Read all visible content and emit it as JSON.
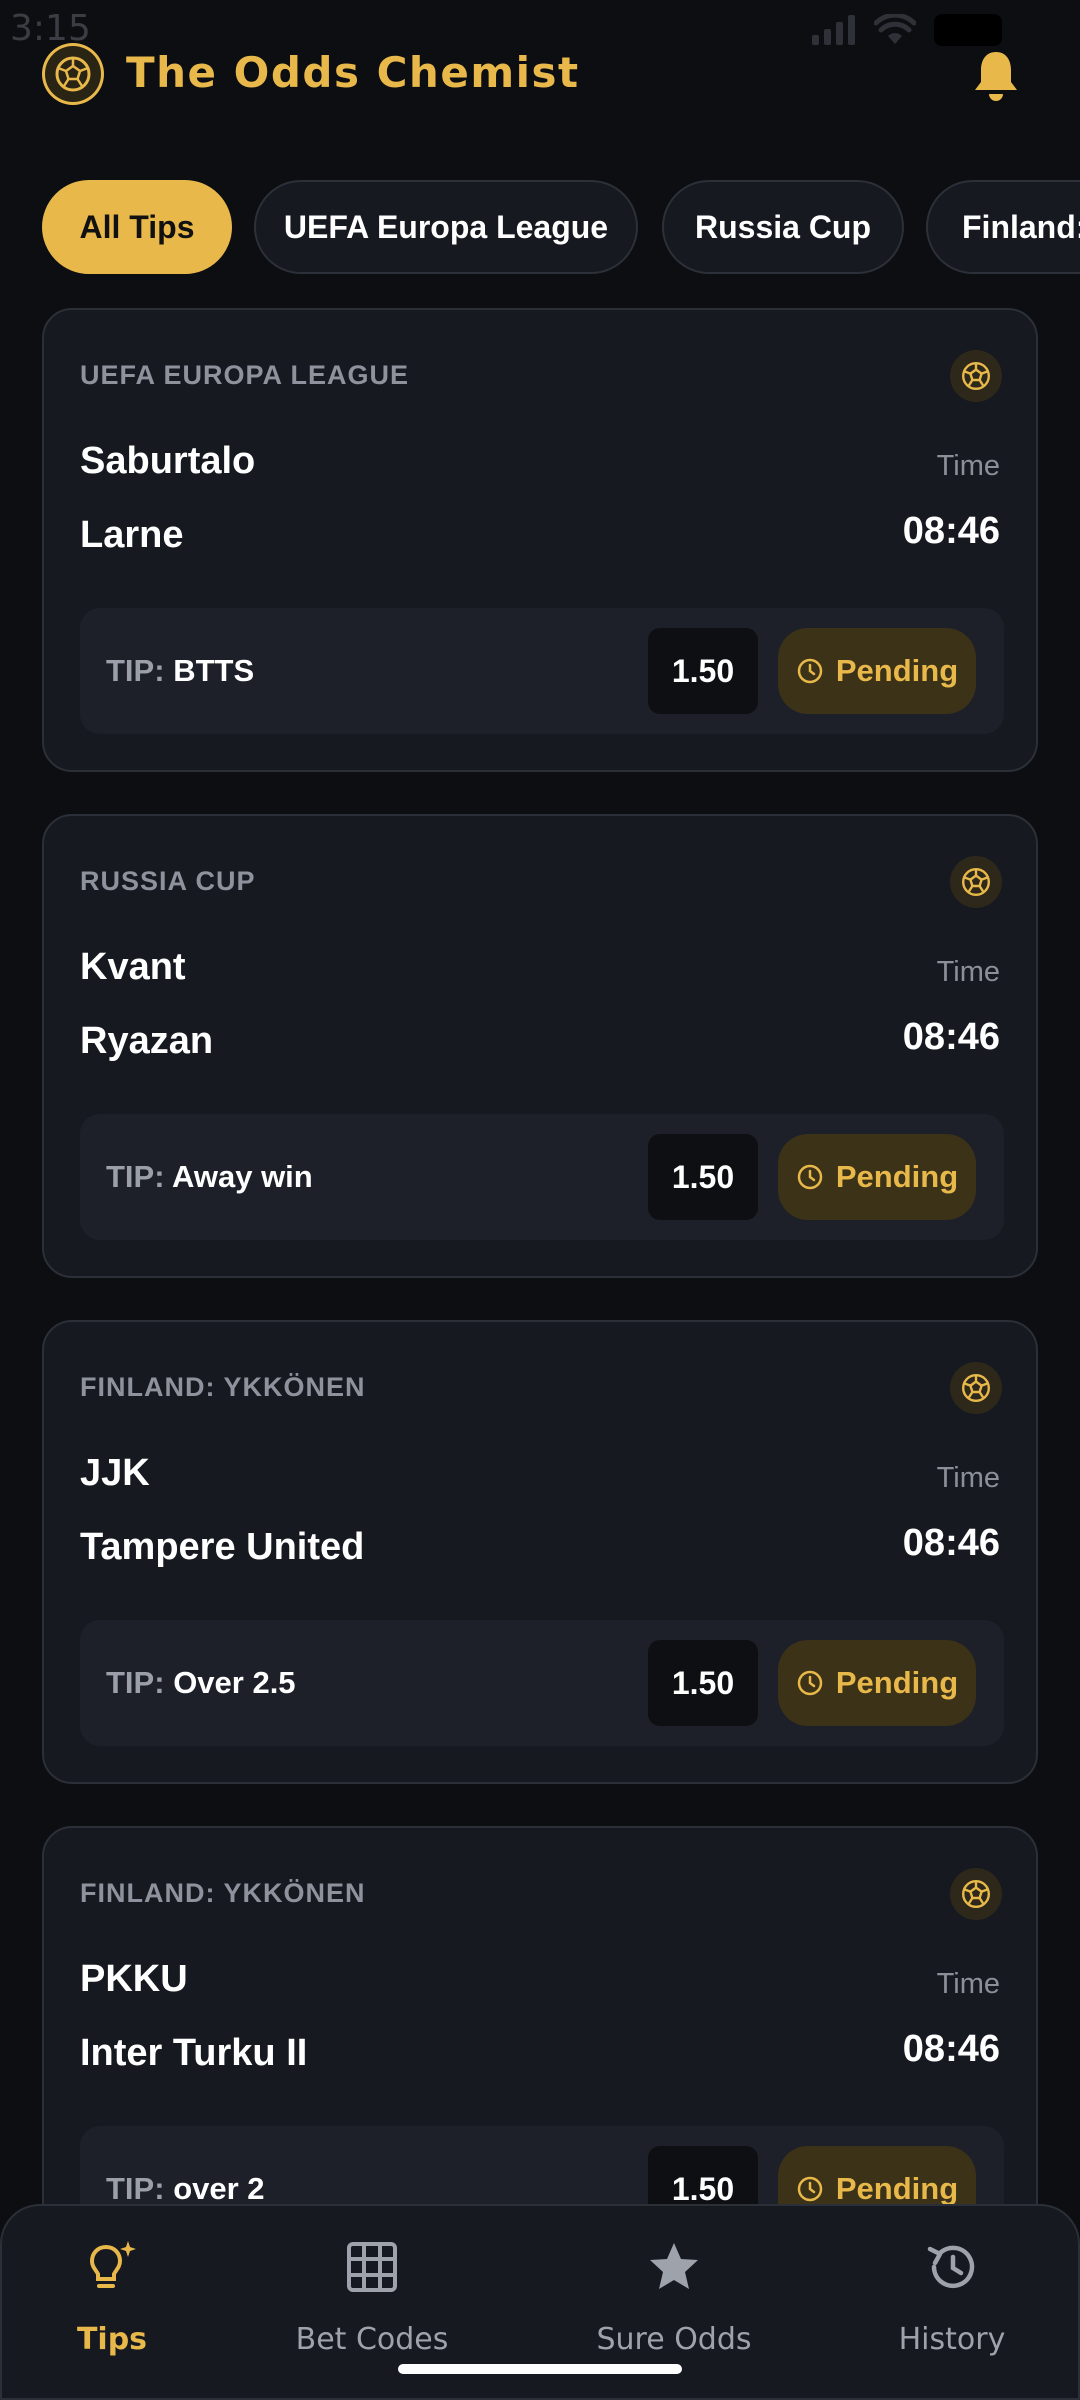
{
  "status_bar": {
    "time": "3:15"
  },
  "header": {
    "title": "The Odds Chemist",
    "logo_icon": "soccer-ball-icon",
    "notification_icon": "bell-icon"
  },
  "colors": {
    "accent": "#e8b84a",
    "background": "#0c0e12",
    "card": "#161920",
    "pending_bg": "#3b3217"
  },
  "filters": [
    {
      "label": "All Tips",
      "active": true
    },
    {
      "label": "UEFA Europa League",
      "active": false
    },
    {
      "label": "Russia Cup",
      "active": false
    },
    {
      "label": "Finland:",
      "active": false
    }
  ],
  "tips": [
    {
      "league": "UEFA EUROPA LEAGUE",
      "home": "Saburtalo",
      "away": "Larne",
      "time_label": "Time",
      "time": "08:46",
      "tip_prefix": "TIP:",
      "tip": "BTTS",
      "odds": "1.50",
      "status": "Pending"
    },
    {
      "league": "RUSSIA CUP",
      "home": "Kvant",
      "away": "Ryazan",
      "time_label": "Time",
      "time": "08:46",
      "tip_prefix": "TIP:",
      "tip": "Away win",
      "odds": "1.50",
      "status": "Pending"
    },
    {
      "league": "FINLAND: YKKÖNEN",
      "home": "JJK",
      "away": "Tampere United",
      "time_label": "Time",
      "time": "08:46",
      "tip_prefix": "TIP:",
      "tip": "Over 2.5",
      "odds": "1.50",
      "status": "Pending"
    },
    {
      "league": "FINLAND: YKKÖNEN",
      "home": "PKKU",
      "away": "Inter Turku II",
      "time_label": "Time",
      "time": "08:46",
      "tip_prefix": "TIP:",
      "tip": "over 2",
      "odds": "1.50",
      "status": "Pending"
    }
  ],
  "nav": [
    {
      "label": "Tips",
      "icon": "lightbulb-icon",
      "active": true
    },
    {
      "label": "Bet Codes",
      "icon": "grid-icon",
      "active": false
    },
    {
      "label": "Sure Odds",
      "icon": "star-icon",
      "active": false
    },
    {
      "label": "History",
      "icon": "history-icon",
      "active": false
    }
  ]
}
